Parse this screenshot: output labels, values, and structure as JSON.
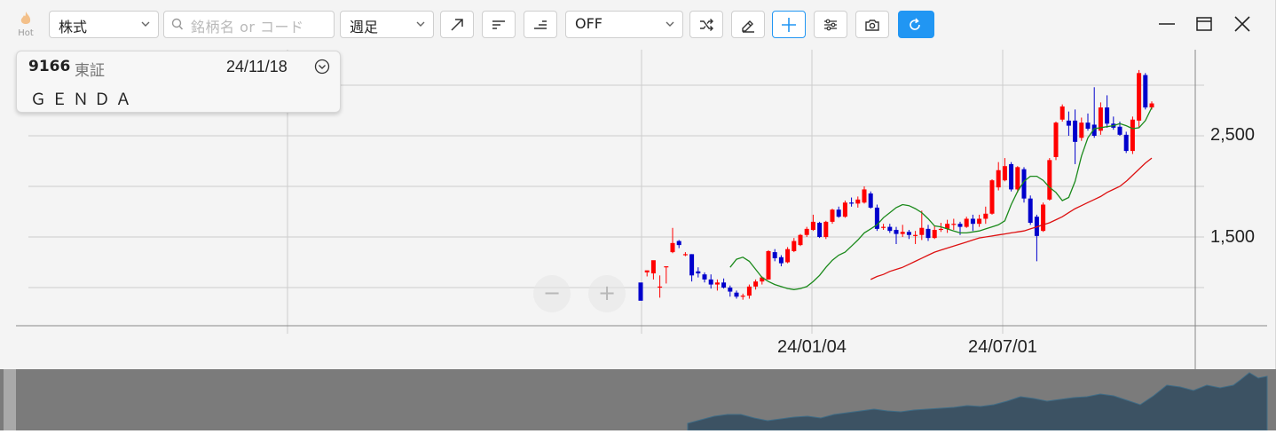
{
  "toolbar": {
    "hot_label": "Hot",
    "type_select": "株式",
    "search_placeholder": "銘柄名 or コード",
    "period_select": "週足",
    "indicator_select": "OFF"
  },
  "info": {
    "code": "9166",
    "market": "東証",
    "date": "24/11/18",
    "name": "ＧＥＮＤＡ"
  },
  "chart_data": {
    "type": "candlestick",
    "y_ticks": [
      "2,500",
      "1,500"
    ],
    "x_ticks": [
      "24/01/04",
      "24/07/01"
    ],
    "ylim": [
      500,
      3300
    ],
    "y_tick_values": [
      2500,
      1500
    ],
    "grid": true,
    "series": [
      {
        "name": "",
        "values": [
          [
            1050,
            870,
            1050,
            1050
          ],
          [
            1150,
            1170,
            1150,
            1110
          ],
          [
            1140,
            1270,
            1140,
            1080
          ],
          [
            1010,
            1010,
            1120,
            900
          ],
          [
            1200,
            1210,
            1210,
            1040
          ],
          [
            1350,
            1440,
            1590,
            1340
          ],
          [
            1460,
            1420,
            1470,
            1390
          ],
          [
            1330,
            1330,
            1350,
            1310
          ],
          [
            1330,
            1120,
            1330,
            1060
          ],
          [
            1160,
            1140,
            1200,
            1100
          ],
          [
            1130,
            1080,
            1150,
            1050
          ],
          [
            1080,
            1030,
            1130,
            990
          ],
          [
            1030,
            1050,
            1080,
            970
          ],
          [
            1050,
            1000,
            1090,
            990
          ],
          [
            1000,
            960,
            1020,
            910
          ],
          [
            950,
            910,
            970,
            890
          ],
          [
            910,
            920,
            940,
            880
          ],
          [
            920,
            1010,
            1030,
            890
          ],
          [
            1010,
            1060,
            1080,
            980
          ],
          [
            1060,
            1100,
            1110,
            1030
          ],
          [
            1080,
            1360,
            1370,
            1080
          ],
          [
            1350,
            1290,
            1380,
            1260
          ],
          [
            1300,
            1240,
            1320,
            1210
          ],
          [
            1250,
            1380,
            1400,
            1240
          ],
          [
            1360,
            1460,
            1490,
            1350
          ],
          [
            1420,
            1520,
            1530,
            1410
          ],
          [
            1520,
            1580,
            1600,
            1500
          ],
          [
            1570,
            1650,
            1720,
            1560
          ],
          [
            1640,
            1500,
            1650,
            1490
          ],
          [
            1500,
            1650,
            1660,
            1480
          ],
          [
            1650,
            1770,
            1780,
            1630
          ],
          [
            1770,
            1700,
            1800,
            1690
          ],
          [
            1700,
            1840,
            1860,
            1690
          ],
          [
            1840,
            1830,
            1890,
            1800
          ],
          [
            1830,
            1870,
            1900,
            1790
          ],
          [
            1840,
            1970,
            2000,
            1830
          ],
          [
            1930,
            1790,
            1950,
            1780
          ],
          [
            1790,
            1580,
            1820,
            1560
          ],
          [
            1590,
            1600,
            1630,
            1570
          ],
          [
            1600,
            1560,
            1630,
            1540
          ],
          [
            1570,
            1530,
            1600,
            1430
          ],
          [
            1530,
            1550,
            1620,
            1500
          ],
          [
            1550,
            1520,
            1570,
            1480
          ],
          [
            1520,
            1520,
            1560,
            1430
          ],
          [
            1520,
            1590,
            1760,
            1470
          ],
          [
            1580,
            1490,
            1620,
            1460
          ],
          [
            1490,
            1570,
            1610,
            1480
          ],
          [
            1570,
            1580,
            1640,
            1550
          ],
          [
            1580,
            1630,
            1670,
            1540
          ],
          [
            1620,
            1630,
            1680,
            1570
          ],
          [
            1630,
            1600,
            1650,
            1520
          ],
          [
            1600,
            1680,
            1700,
            1590
          ],
          [
            1680,
            1630,
            1720,
            1560
          ],
          [
            1630,
            1680,
            1720,
            1600
          ],
          [
            1680,
            1730,
            1800,
            1630
          ],
          [
            1730,
            2060,
            2070,
            1720
          ],
          [
            1990,
            2160,
            2240,
            1960
          ],
          [
            2060,
            2200,
            2280,
            2050
          ],
          [
            2220,
            1970,
            2240,
            1950
          ],
          [
            1970,
            2190,
            2200,
            1940
          ],
          [
            2170,
            1880,
            2190,
            1840
          ],
          [
            1880,
            1640,
            1910,
            1620
          ],
          [
            1700,
            1510,
            1720,
            1260
          ],
          [
            1560,
            1820,
            1840,
            1550
          ],
          [
            1870,
            2260,
            2280,
            1860
          ],
          [
            2290,
            2630,
            2640,
            2260
          ],
          [
            2660,
            2790,
            2810,
            2640
          ],
          [
            2650,
            2600,
            2740,
            2500
          ],
          [
            2650,
            2440,
            2760,
            2220
          ],
          [
            2480,
            2630,
            2680,
            2450
          ],
          [
            2630,
            2570,
            2720,
            2550
          ],
          [
            2610,
            2500,
            2980,
            2480
          ],
          [
            2550,
            2780,
            2830,
            2510
          ],
          [
            2780,
            2620,
            2900,
            2580
          ],
          [
            2620,
            2580,
            2690,
            2560
          ],
          [
            2590,
            2510,
            2640,
            2500
          ],
          [
            2510,
            2350,
            2540,
            2330
          ],
          [
            2350,
            2660,
            2690,
            2320
          ],
          [
            2650,
            3120,
            3150,
            2580
          ],
          [
            3100,
            2780,
            3120,
            2760
          ],
          [
            2780,
            2820,
            2840,
            2760
          ]
        ]
      },
      {
        "name": "",
        "values": [
          1200,
          1280,
          1300,
          1260,
          1180,
          1100,
          1060,
          1030,
          1010,
          990,
          980,
          990,
          1010,
          1060,
          1120,
          1200,
          1270,
          1320,
          1350,
          1410,
          1470,
          1540,
          1580,
          1620,
          1690,
          1740,
          1790,
          1820,
          1810,
          1780,
          1740,
          1680,
          1610,
          1600,
          1580,
          1560,
          1540,
          1540,
          1550,
          1560,
          1580,
          1600,
          1620,
          1660,
          1820,
          1950,
          2050,
          2100,
          2100,
          2060,
          1990,
          1940,
          1860,
          1890,
          2050,
          2300,
          2480,
          2570,
          2580,
          2590,
          2600,
          2620,
          2600,
          2570,
          2580,
          2650,
          2780
        ]
      },
      {
        "name": "",
        "values": [
          1080,
          1110,
          1130,
          1160,
          1180,
          1200,
          1230,
          1260,
          1290,
          1320,
          1350,
          1370,
          1390,
          1410,
          1430,
          1450,
          1470,
          1490,
          1500,
          1510,
          1520,
          1530,
          1540,
          1550,
          1560,
          1580,
          1600,
          1620,
          1640,
          1670,
          1700,
          1740,
          1780,
          1810,
          1840,
          1870,
          1900,
          1940,
          1970,
          2000,
          2050,
          2110,
          2170,
          2230,
          2280
        ]
      }
    ]
  },
  "colors": {
    "up_candle": "#ff0000",
    "down_candle": "#0000cc",
    "ma_short": "#1b8a1b",
    "ma_long": "#dd1111",
    "grid": "#cfcfcf",
    "accent": "#2196f3",
    "navigator_bg": "#7b7b7b",
    "navigator_area": "#3c5263"
  }
}
